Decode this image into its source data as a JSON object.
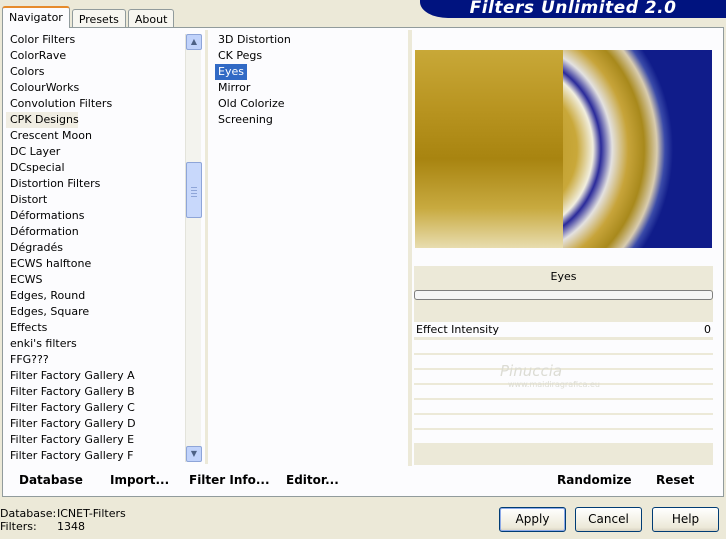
{
  "app_title": "Filters Unlimited 2.0",
  "tabs": [
    "Navigator",
    "Presets",
    "About"
  ],
  "categories": [
    "Color Filters",
    "ColorRave",
    "Colors",
    "ColourWorks",
    "Convolution Filters",
    "CPK Designs",
    "Crescent Moon",
    "DC Layer",
    "DCspecial",
    "Distortion Filters",
    "Distort",
    "Déformations",
    "Déformation",
    "Dégradés",
    "ECWS halftone",
    "ECWS",
    "Edges, Round",
    "Edges, Square",
    "Effects",
    "enki's filters",
    "FFG???",
    "Filter Factory Gallery A",
    "Filter Factory Gallery B",
    "Filter Factory Gallery C",
    "Filter Factory Gallery D",
    "Filter Factory Gallery E",
    "Filter Factory Gallery F"
  ],
  "selected_category": "CPK Designs",
  "filters": [
    "3D Distortion",
    "CK Pegs",
    "Eyes",
    "Mirror",
    "Old Colorize",
    "Screening"
  ],
  "selected_filter": "Eyes",
  "preview_filter_name": "Eyes",
  "param": {
    "label": "Effect Intensity",
    "value": "0"
  },
  "watermark": {
    "line1": "Pinuccia",
    "line2": "www.maidiragrafica.eu"
  },
  "buttons": {
    "database": "Database",
    "import": "Import...",
    "filter_info": "Filter Info...",
    "editor": "Editor...",
    "randomize": "Randomize",
    "reset": "Reset",
    "apply": "Apply",
    "cancel": "Cancel",
    "help": "Help"
  },
  "info": {
    "db_label": "Database:",
    "db_value": "ICNET-Filters",
    "filters_label": "Filters:",
    "filters_value": "1348"
  },
  "colors": {
    "accent": "#316ac5",
    "banner": "#00137f"
  }
}
